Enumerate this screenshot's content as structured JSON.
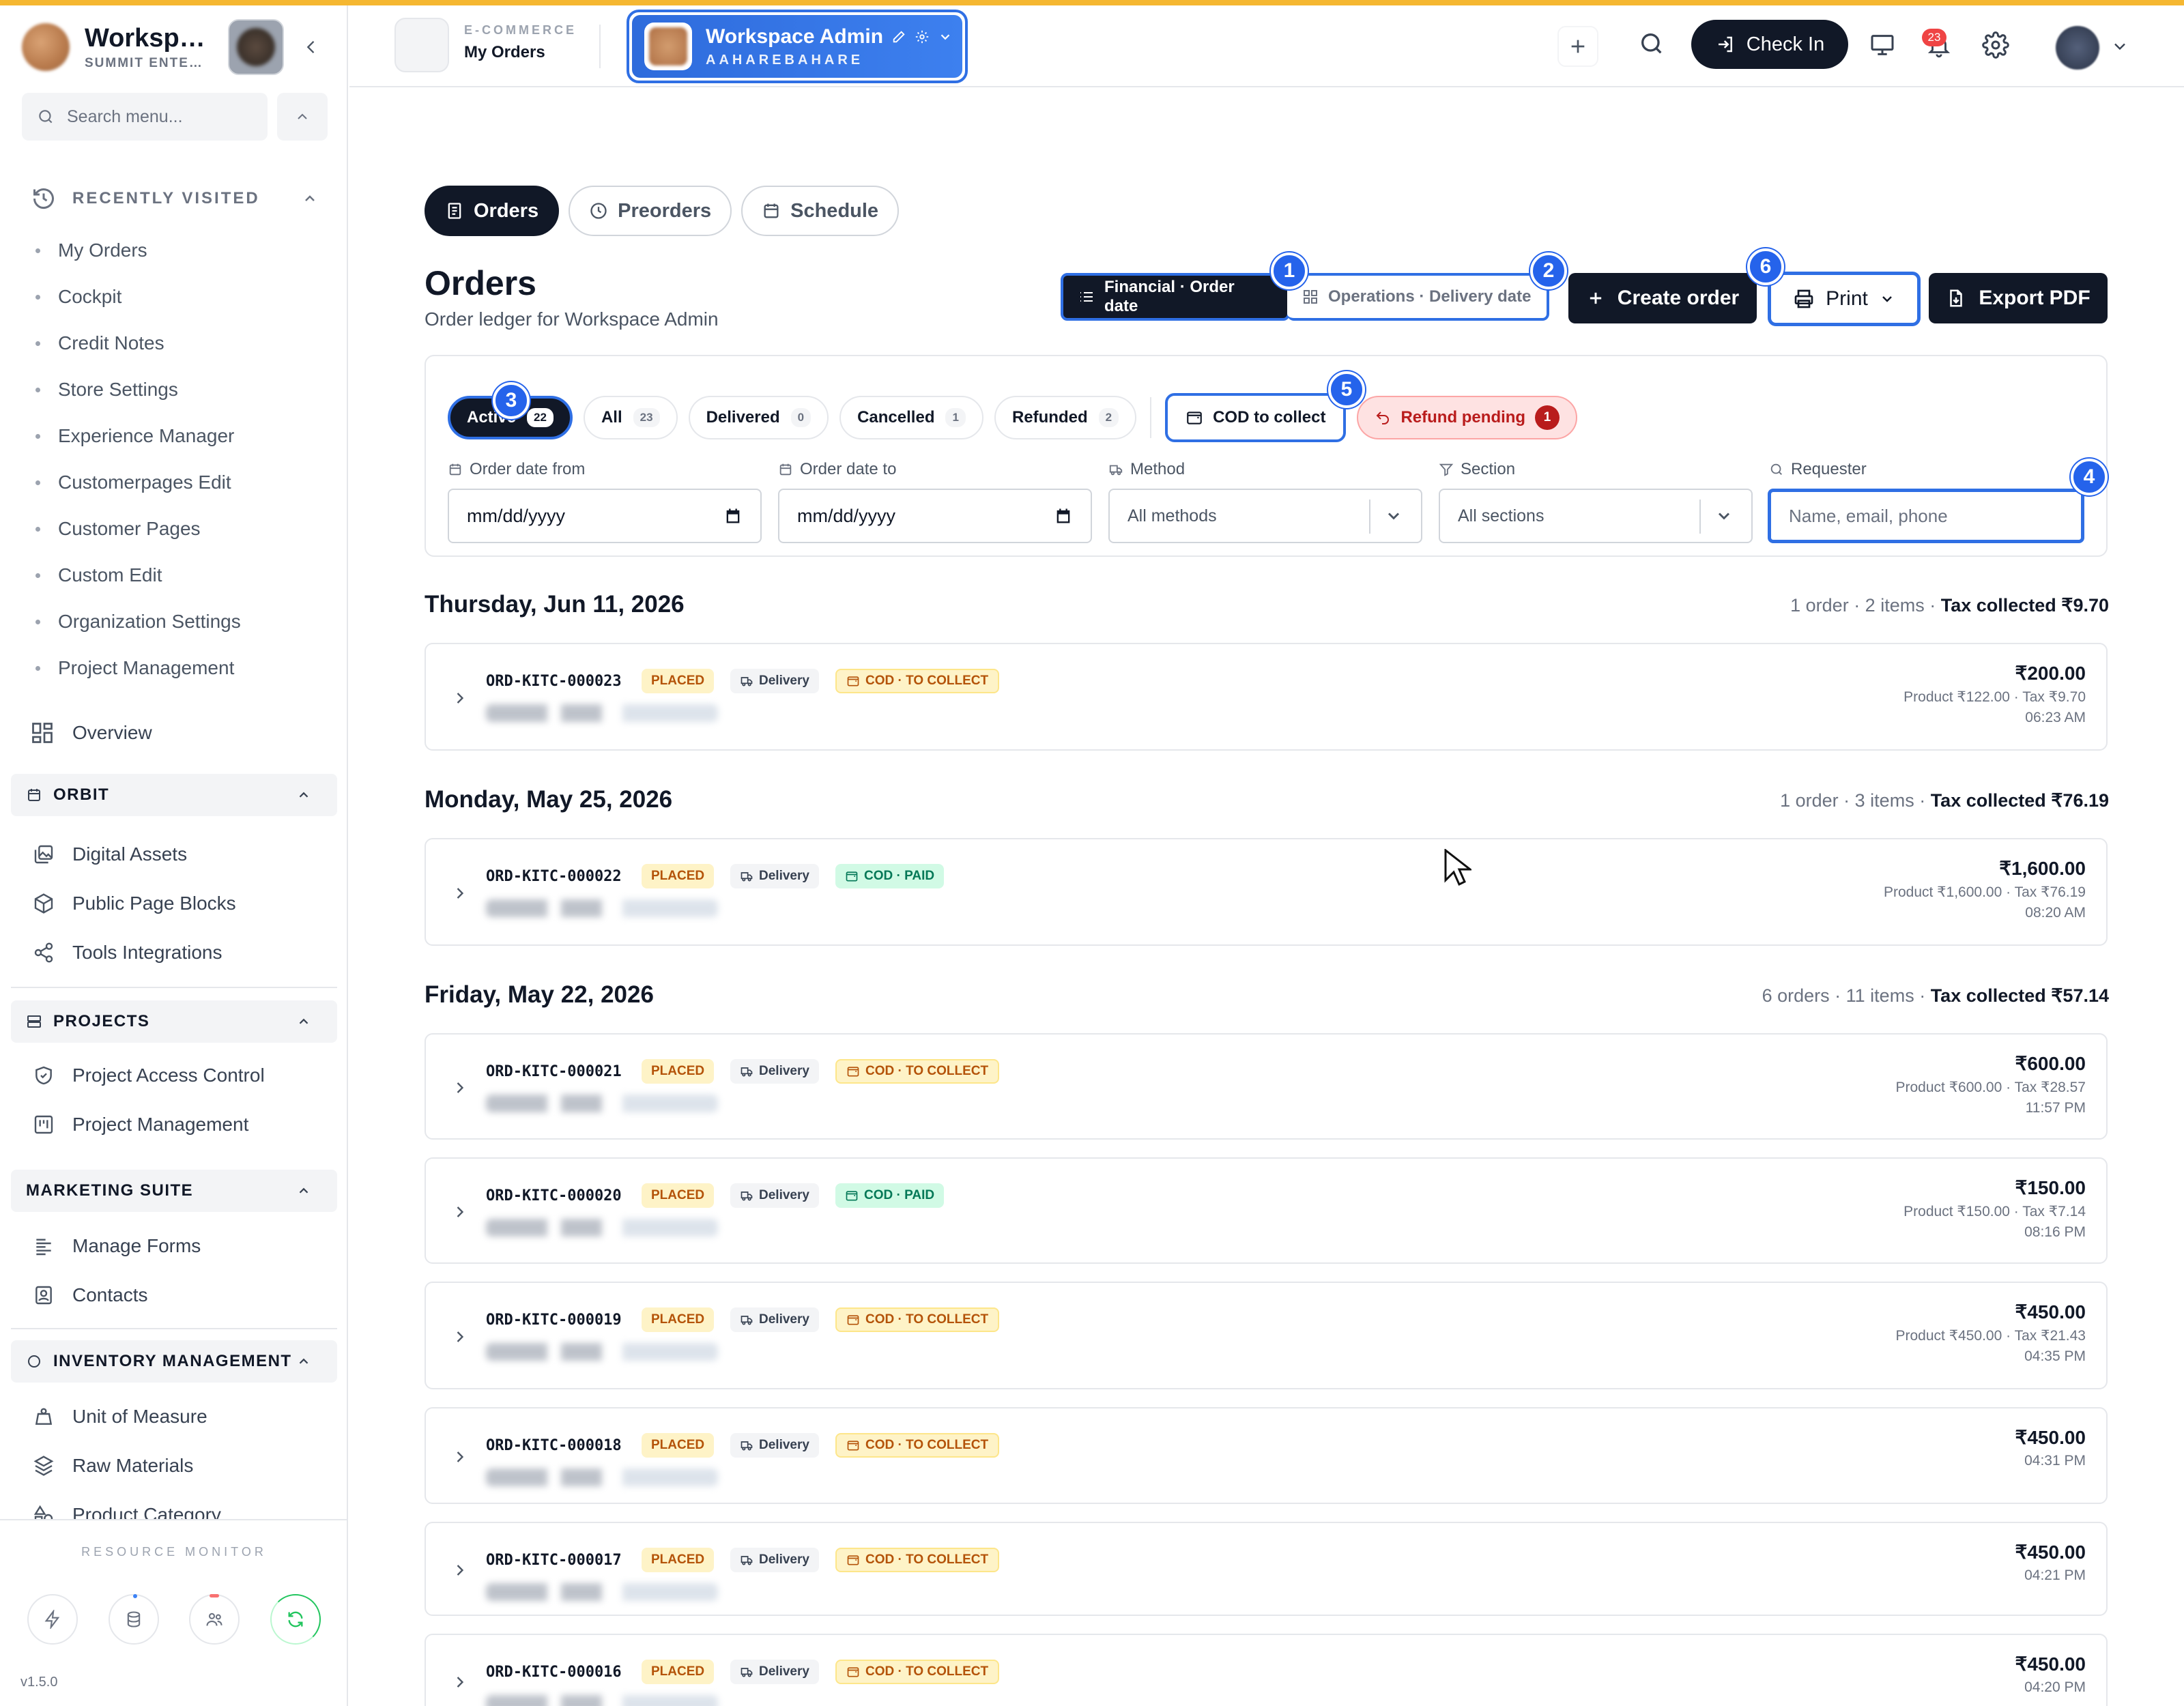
{
  "sidebar": {
    "workspace_name": "Worksp…",
    "workspace_sub": "SUMMIT ENTE…",
    "search_placeholder": "Search menu...",
    "recently_visited_title": "RECENTLY VISITED",
    "recent_items": [
      "My Orders",
      "Cockpit",
      "Credit Notes",
      "Store Settings",
      "Experience Manager",
      "Customerpages Edit",
      "Customer Pages",
      "Custom Edit",
      "Organization Settings",
      "Project Management"
    ],
    "overview": "Overview",
    "sections": [
      {
        "title": "ORBIT",
        "items": [
          "Digital Assets",
          "Public Page Blocks",
          "Tools Integrations"
        ]
      },
      {
        "title": "PROJECTS",
        "items": [
          "Project Access Control",
          "Project Management"
        ]
      },
      {
        "title": "MARKETING SUITE",
        "items": [
          "Manage Forms",
          "Contacts"
        ]
      },
      {
        "title": "INVENTORY MANAGEMENT",
        "items": [
          "Unit of Measure",
          "Raw Materials",
          "Product Category"
        ]
      }
    ],
    "resource_monitor": "RESOURCE MONITOR",
    "version": "v1.5.0"
  },
  "header": {
    "crumb_section": "E-COMMERCE",
    "crumb_page": "My Orders",
    "workspace_title": "Workspace Admin",
    "workspace_slug": "AAHAREBAHARE",
    "check_in": "Check In",
    "notifications_count": "23"
  },
  "tabs": [
    "Orders",
    "Preorders",
    "Schedule"
  ],
  "page": {
    "title": "Orders",
    "subtitle": "Order ledger for Workspace Admin",
    "view_financial": "Financial · Order date",
    "view_operations": "Operations · Delivery date",
    "create_order": "Create order",
    "print": "Print",
    "export_pdf": "Export PDF"
  },
  "tour_steps": [
    "1",
    "2",
    "3",
    "4",
    "5",
    "6"
  ],
  "filters": {
    "status_chips": [
      {
        "label": "Active",
        "count": "22"
      },
      {
        "label": "All",
        "count": "23"
      },
      {
        "label": "Delivered",
        "count": "0"
      },
      {
        "label": "Cancelled",
        "count": "1"
      },
      {
        "label": "Refunded",
        "count": "2"
      }
    ],
    "cod_chip": "COD to collect",
    "refund_chip": "Refund pending",
    "refund_count": "1",
    "date_from_label": "Order date from",
    "date_from_value": "mm/dd/yyyy",
    "date_to_label": "Order date to",
    "date_to_value": "mm/dd/yyyy",
    "method_label": "Method",
    "method_value": "All methods",
    "section_label": "Section",
    "section_value": "All sections",
    "requester_label": "Requester",
    "requester_placeholder": "Name, email, phone"
  },
  "days": [
    {
      "date": "Thursday, Jun 11, 2026",
      "summary": "1 order · 2 items · ",
      "tax": "Tax collected ₹9.70",
      "orders": [
        {
          "id": "ORD-KITC-000023",
          "status": "PLACED",
          "method": "Delivery",
          "cod": "COD · TO COLLECT",
          "cod_type": "collect",
          "amount": "₹200.00",
          "detail": "Product ₹122.00 · Tax ₹9.70",
          "time": "06:23 AM"
        }
      ]
    },
    {
      "date": "Monday, May 25, 2026",
      "summary": "1 order · 3 items · ",
      "tax": "Tax collected ₹76.19",
      "orders": [
        {
          "id": "ORD-KITC-000022",
          "status": "PLACED",
          "method": "Delivery",
          "cod": "COD · PAID",
          "cod_type": "paid",
          "amount": "₹1,600.00",
          "detail": "Product ₹1,600.00 · Tax ₹76.19",
          "time": "08:20 AM"
        }
      ]
    },
    {
      "date": "Friday, May 22, 2026",
      "summary": "6 orders · 11 items · ",
      "tax": "Tax collected ₹57.14",
      "orders": [
        {
          "id": "ORD-KITC-000021",
          "status": "PLACED",
          "method": "Delivery",
          "cod": "COD · TO COLLECT",
          "cod_type": "collect",
          "amount": "₹600.00",
          "detail": "Product ₹600.00 · Tax ₹28.57",
          "time": "11:57 PM"
        },
        {
          "id": "ORD-KITC-000020",
          "status": "PLACED",
          "method": "Delivery",
          "cod": "COD · PAID",
          "cod_type": "paid",
          "amount": "₹150.00",
          "detail": "Product ₹150.00 · Tax ₹7.14",
          "time": "08:16 PM"
        },
        {
          "id": "ORD-KITC-000019",
          "status": "PLACED",
          "method": "Delivery",
          "cod": "COD · TO COLLECT",
          "cod_type": "collect",
          "amount": "₹450.00",
          "detail": "Product ₹450.00 · Tax ₹21.43",
          "time": "04:35 PM"
        },
        {
          "id": "ORD-KITC-000018",
          "status": "PLACED",
          "method": "Delivery",
          "cod": "COD · TO COLLECT",
          "cod_type": "collect",
          "amount": "₹450.00",
          "detail": "",
          "time": "04:31 PM"
        },
        {
          "id": "ORD-KITC-000017",
          "status": "PLACED",
          "method": "Delivery",
          "cod": "COD · TO COLLECT",
          "cod_type": "collect",
          "amount": "₹450.00",
          "detail": "",
          "time": "04:21 PM"
        },
        {
          "id": "ORD-KITC-000016",
          "status": "PLACED",
          "method": "Delivery",
          "cod": "COD · TO COLLECT",
          "cod_type": "collect",
          "amount": "₹450.00",
          "detail": "",
          "time": "04:20 PM"
        }
      ]
    }
  ],
  "colors": {
    "accent": "#2f6fe4",
    "dark": "#111827",
    "stripe": "#f5b731",
    "placed_bg": "#fef3c7",
    "paid_bg": "#d1fae5"
  }
}
